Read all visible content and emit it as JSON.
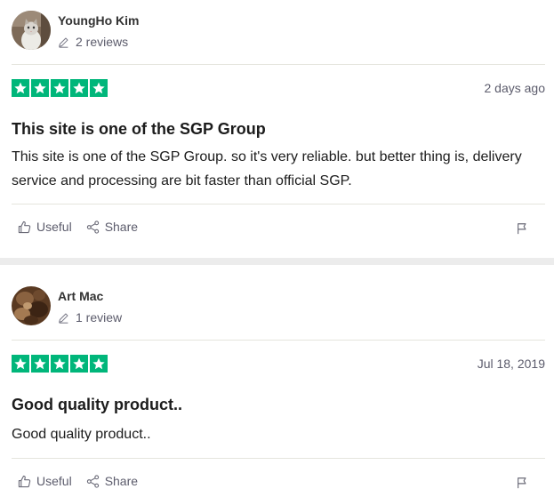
{
  "reviews": [
    {
      "consumer_name": "YoungHo Kim",
      "review_count": "2 reviews",
      "avatar": "cat-photo-avatar",
      "rating": 5,
      "date": "2 days ago",
      "title": "This site is one of the SGP Group",
      "text": "This site is one of the SGP Group. so it's very reliable. but better thing is, delivery service and processing are bit faster than official SGP.",
      "useful_label": "Useful",
      "share_label": "Share"
    },
    {
      "consumer_name": "Art Mac",
      "review_count": "1 review",
      "avatar": "rock-photo-avatar",
      "rating": 5,
      "date": "Jul 18, 2019",
      "title": "Good quality product..",
      "text": "Good quality product..",
      "useful_label": "Useful",
      "share_label": "Share"
    }
  ],
  "colors": {
    "star_green": "#00b67a",
    "text_dark": "#1c1c1c",
    "text_muted": "#5c5c6c",
    "divider": "#e5e5dd",
    "section_gap": "#ececec"
  },
  "icons": [
    "pencil-icon",
    "star-icon",
    "thumbs-up-icon",
    "share-icon",
    "flag-icon"
  ]
}
